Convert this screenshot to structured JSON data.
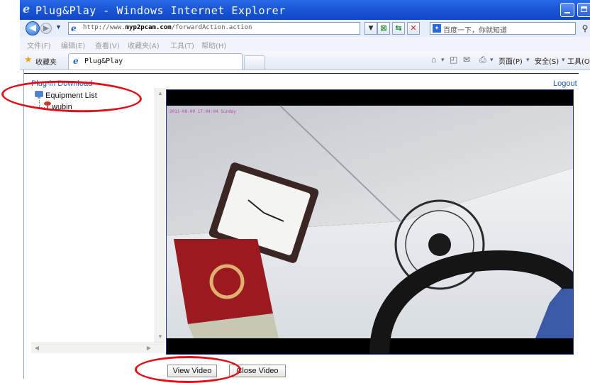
{
  "window": {
    "title": "Plug&Play - Windows Internet Explorer"
  },
  "address_bar": {
    "url_prefix": "http://www.",
    "url_domain": "myp2pcam.com",
    "url_path": "/forwardAction.action",
    "search_placeholder": "百度一下，你就知道"
  },
  "menu": {
    "items": [
      "文件(F)",
      "编辑(E)",
      "查看(V)",
      "收藏夹(A)",
      "工具(T)",
      "帮助(H)"
    ]
  },
  "favorites_bar": {
    "favorites_label": "收藏夹",
    "tab_label": "Plug&Play",
    "page_menu": "页面(P)",
    "safety_menu": "安全(S)",
    "tools_menu": "工具(O)"
  },
  "page": {
    "plugin_download": "Plug-in Download",
    "logout": "Logout",
    "tree": {
      "root_label": "Equipment List",
      "child_label": "wubin"
    },
    "video_timestamp": "2011-08-09 17:04:04 Sunday",
    "view_video_label": "View Video",
    "close_video_label": "Close Video"
  },
  "colors": {
    "annotation_circle": "#e0101a",
    "titlebar": "#1c58d8",
    "link": "#1e56b8"
  }
}
